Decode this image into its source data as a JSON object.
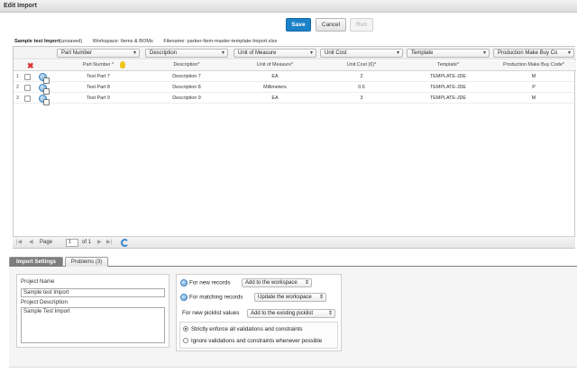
{
  "window": {
    "title": "Edit Import"
  },
  "toolbar": {
    "save_label": "Save",
    "cancel_label": "Cancel",
    "run_label": "Run"
  },
  "info": {
    "import_name": "Sample test Import",
    "unsaved": "(unsaved)",
    "workspace": "Workspace: Items & BOMs",
    "filename": "Filename: parker-Item-master-template-Import.xlsx"
  },
  "grid": {
    "column_selects": [
      "Part Number",
      "Description",
      "Unit of Measure",
      "Unit Cost",
      "Template",
      "Production Make Buy Co"
    ],
    "column_headers": [
      "Part Number *",
      "Description*",
      "Unit of Measure*",
      "Unit Cost (€)*",
      "Template*",
      "Production Make Buy Code*"
    ],
    "rows": [
      {
        "num": "1",
        "cells": [
          "Test Part 7",
          "Description 7",
          "EA",
          "2",
          "TEMPLATE-JDE",
          "M"
        ]
      },
      {
        "num": "2",
        "cells": [
          "Test Part 8",
          "Description 8",
          "Millimeters",
          "0.6",
          "TEMPLATE-JDE",
          "P"
        ]
      },
      {
        "num": "3",
        "cells": [
          "Test Part 9",
          "Description 9",
          "EA",
          "3",
          "TEMPLATE-JDE",
          "M"
        ]
      }
    ]
  },
  "pager": {
    "page_label": "Page",
    "page_value": "1",
    "of_label": "of 1"
  },
  "tabs": {
    "settings": "Import Settings",
    "problems": "Problems (3)"
  },
  "project": {
    "name_label": "Project Name",
    "name_value": "Sample test Import",
    "desc_label": "Project Description",
    "desc_value": "Sample Test Import"
  },
  "options": {
    "new_records_label": "For new records",
    "new_records_value": "Add to the workspace",
    "matching_label": "For matching records",
    "matching_value": "Update the workspace",
    "picklist_label": "For new picklist values",
    "picklist_value": "Add to the existing picklist",
    "strict_label": "Strictly enforce all validations and constraints",
    "ignore_label": "Ignore validations and constraints whenever possible"
  }
}
